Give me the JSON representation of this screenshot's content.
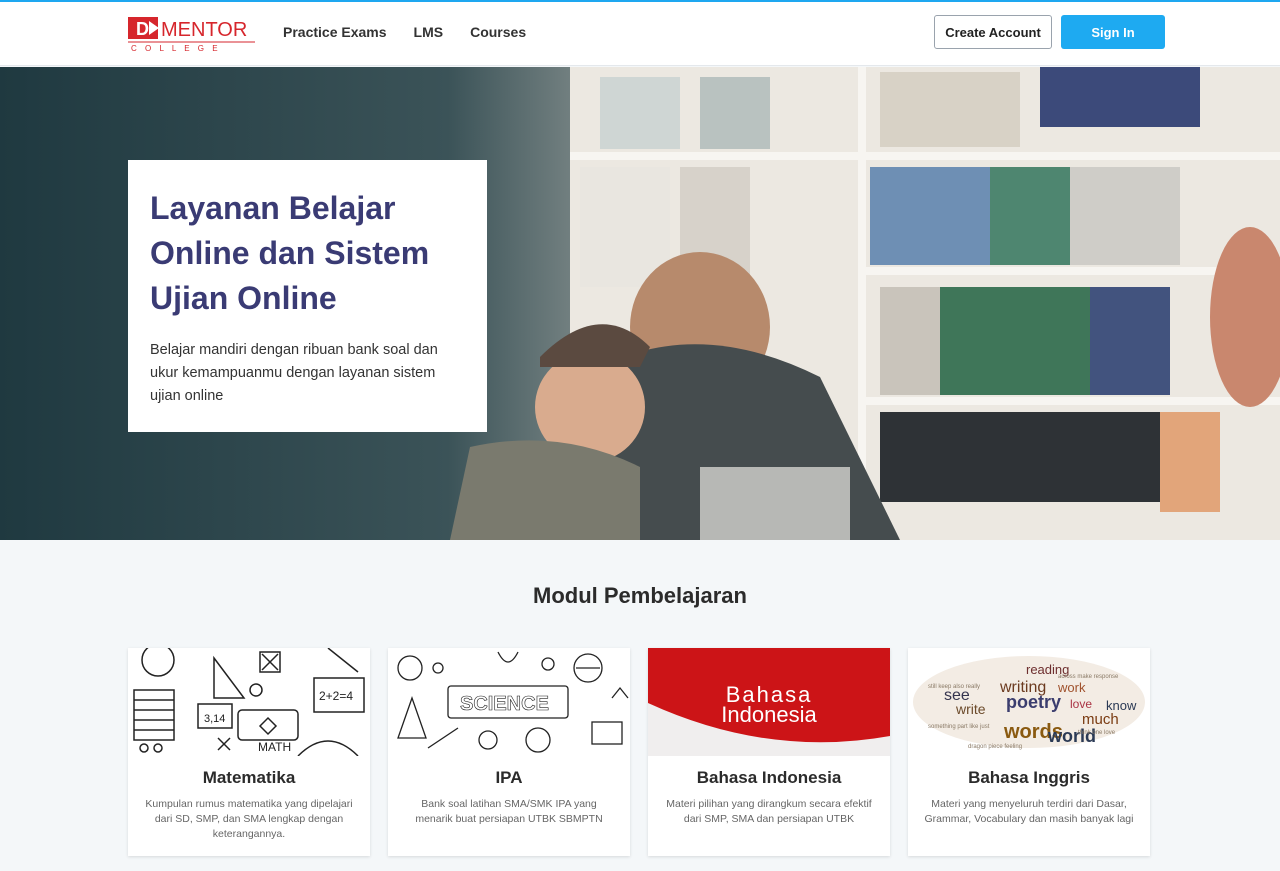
{
  "brand": {
    "logo_main": "MENTOR",
    "logo_sub": "C O L L E G E",
    "logo_mark": "D"
  },
  "nav": {
    "items": [
      "Practice Exams",
      "LMS",
      "Courses"
    ]
  },
  "auth": {
    "create_account": "Create Account",
    "sign_in": "Sign In"
  },
  "hero": {
    "title_lines": [
      "Layanan Belajar",
      "Online dan Sistem",
      "Ujian Online"
    ],
    "description": "Belajar mandiri dengan ribuan bank soal dan ukur kemampuanmu dengan layanan sistem ujian online"
  },
  "modules": {
    "title": "Modul Pembelajaran",
    "cards": [
      {
        "title": "Matematika",
        "description": "Kumpulan rumus matematika yang dipelajari dari SD, SMP, dan SMA lengkap dengan keterangannya."
      },
      {
        "title": "IPA",
        "description": "Bank soal latihan SMA/SMK IPA yang menarik buat persiapan UTBK SBMPTN",
        "image_text": "SCIENCE"
      },
      {
        "title": "Bahasa Indonesia",
        "description": "Materi pilihan yang dirangkum secara efektif dari SMP, SMA dan persiapan UTBK",
        "image_text": [
          "Bahasa",
          "Indonesia"
        ]
      },
      {
        "title": "Bahasa Inggris",
        "description": "Materi yang menyeluruh terdiri dari Dasar, Grammar, Vocabulary dan masih banyak lagi",
        "image_words": [
          "writing",
          "poetry",
          "words",
          "world",
          "reading",
          "work",
          "see",
          "write",
          "know",
          "much",
          "love"
        ]
      }
    ]
  },
  "colors": {
    "accent": "#1eaaf1",
    "heading": "#3a3b74",
    "logo_red": "#d6262c",
    "indo_red": "#cc1417"
  },
  "math_image": {
    "labels": [
      "2+2=4",
      "3,14",
      "MATH"
    ]
  }
}
